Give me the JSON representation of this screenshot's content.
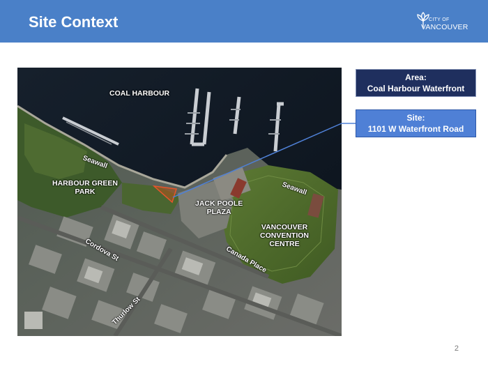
{
  "header": {
    "title": "Site Context",
    "background": "#4a80c8"
  },
  "logo": {
    "city_of": "CITY OF",
    "name": "VANCOUVER",
    "icon": "flower-logo-icon"
  },
  "map": {
    "labels": {
      "coal_harbour": "COAL HARBOUR",
      "harbour_green_park": "HARBOUR GREEN\nPARK",
      "jack_poole_plaza": "JACK POOLE\nPLAZA",
      "convention_centre": "VANCOUVER\nCONVENTION\nCENTRE"
    },
    "streets": {
      "seawall_west": "Seawall",
      "seawall_east": "Seawall",
      "cordova": "Cordova St",
      "canada_place": "Canada Place",
      "thurlow": "Thurlow St"
    },
    "site_outline_color": "#e8552b"
  },
  "callouts": {
    "area_heading": "Area:",
    "area_value": "Coal Harbour Waterfront",
    "site_heading": "Site:",
    "site_value": "1101 W Waterfront Road"
  },
  "colors": {
    "area_box": "#1f2f5e",
    "site_box": "#4f80d6",
    "connector": "#4f80d6"
  },
  "page_number": "2"
}
